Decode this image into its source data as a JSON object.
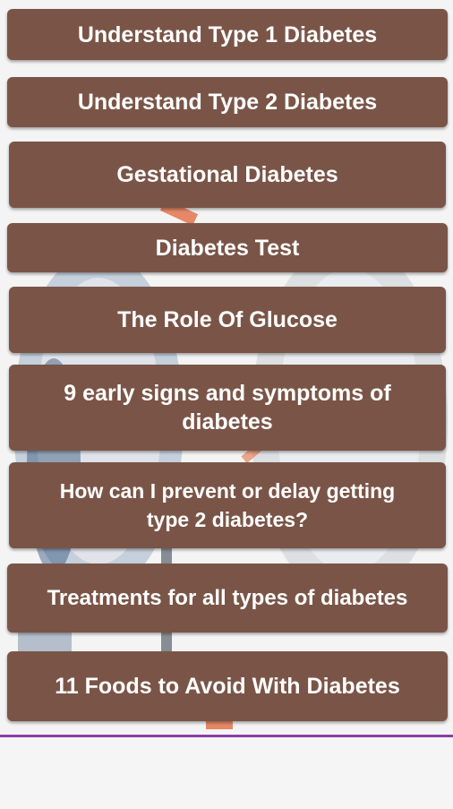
{
  "menu": {
    "items": [
      {
        "label": "Understand Type 1 Diabetes"
      },
      {
        "label": "Understand Type 2 Diabetes"
      },
      {
        "label": "Gestational Diabetes"
      },
      {
        "label": "Diabetes Test"
      },
      {
        "label": "The Role Of Glucose"
      },
      {
        "label": "9 early signs and symptoms of diabetes"
      },
      {
        "label": "How can I prevent or delay getting type 2 diabetes?"
      },
      {
        "label": "Treatments for all types of diabetes"
      },
      {
        "label": "11 Foods to Avoid With Diabetes"
      }
    ]
  },
  "colors": {
    "button": "#7a5547",
    "button_text": "#ffffff",
    "accent_bar": "#8a3ea6"
  }
}
